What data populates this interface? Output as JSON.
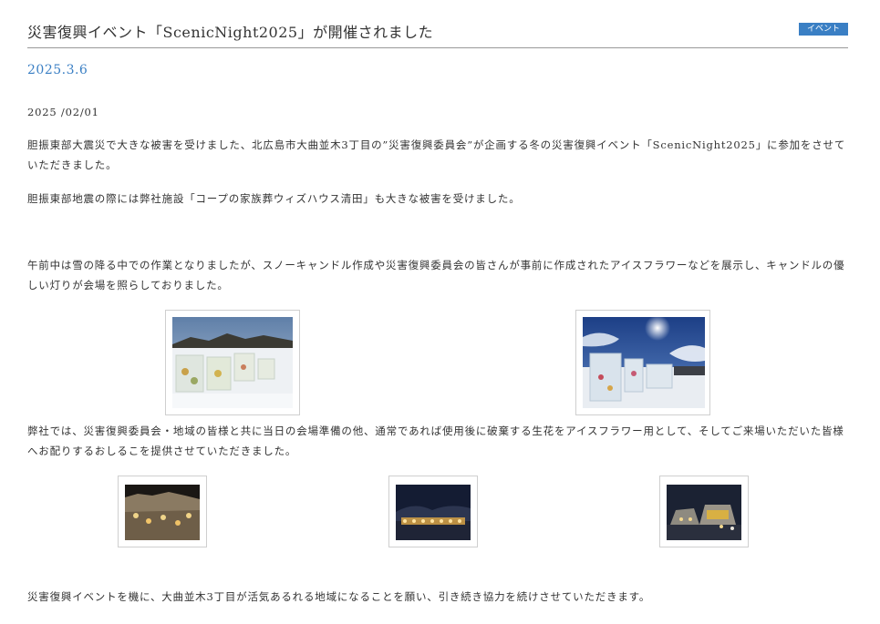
{
  "header": {
    "title": "災害復興イベント「ScenicNight2025」が開催されました",
    "badge": "イベント"
  },
  "post_date": "2025.3.6",
  "event_date": "2025 /02/01",
  "paragraphs": [
    "胆振東部大震災で大きな被害を受けました、北広島市大曲並木3丁目の”災害復興委員会”が企画する冬の災害復興イベント「ScenicNight2025」に参加をさせていただきました。",
    "胆振東部地震の際には弊社施設「コープの家族葬ウィズハウス清田」も大きな被害を受けました。",
    "午前中は雪の降る中での作業となりましたが、スノーキャンドル作成や災害復興委員会の皆さんが事前に作成されたアイスフラワーなどを展示し、キャンドルの優しい灯りが会場を照らしておりました。",
    "弊社では、災害復興委員会・地域の皆様と共に当日の会場準備の他、通常であれば使用後に破棄する生花をアイスフラワー用として、そしてご来場いただいた皆様へお配りするおしるこを提供させていただきました。",
    "災害復興イベントを機に、大曲並木3丁目が活気あるれる地域になることを願い、引き続き協力を続けさせていただきます。"
  ],
  "colors": {
    "accent": "#3a7fc4",
    "text": "#333333",
    "rule": "#999999"
  }
}
